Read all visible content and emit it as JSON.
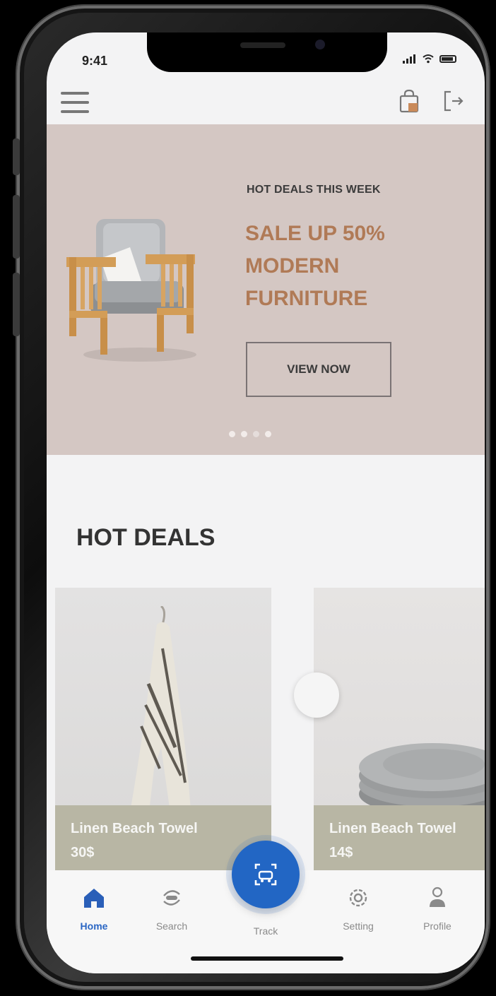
{
  "status_bar": {
    "time": "9:41"
  },
  "banner": {
    "subtitle": "HOT DEALS THIS WEEK",
    "title_lines": [
      "SALE UP 50%",
      "MODERN",
      "FURNITURE"
    ],
    "button_label": "VIEW NOW",
    "slide_count": 4,
    "active_slide": 3,
    "accent_color": "#b07a56"
  },
  "hot_deals": {
    "title": "HOT DEALS",
    "products": [
      {
        "name": "Linen Beach Towel",
        "price": "30$"
      },
      {
        "name": "Linen Beach Towel",
        "price": "14$"
      }
    ]
  },
  "tab_bar": {
    "tabs": [
      {
        "label": "Home",
        "icon": "home-icon",
        "active": true
      },
      {
        "label": "Search",
        "icon": "search-icon",
        "active": false
      },
      {
        "label": "Track",
        "icon": "track-icon",
        "active": false
      },
      {
        "label": "Setting",
        "icon": "gear-icon",
        "active": false
      },
      {
        "label": "Profile",
        "icon": "user-icon",
        "active": false
      }
    ],
    "accent_color": "#2266c4"
  }
}
